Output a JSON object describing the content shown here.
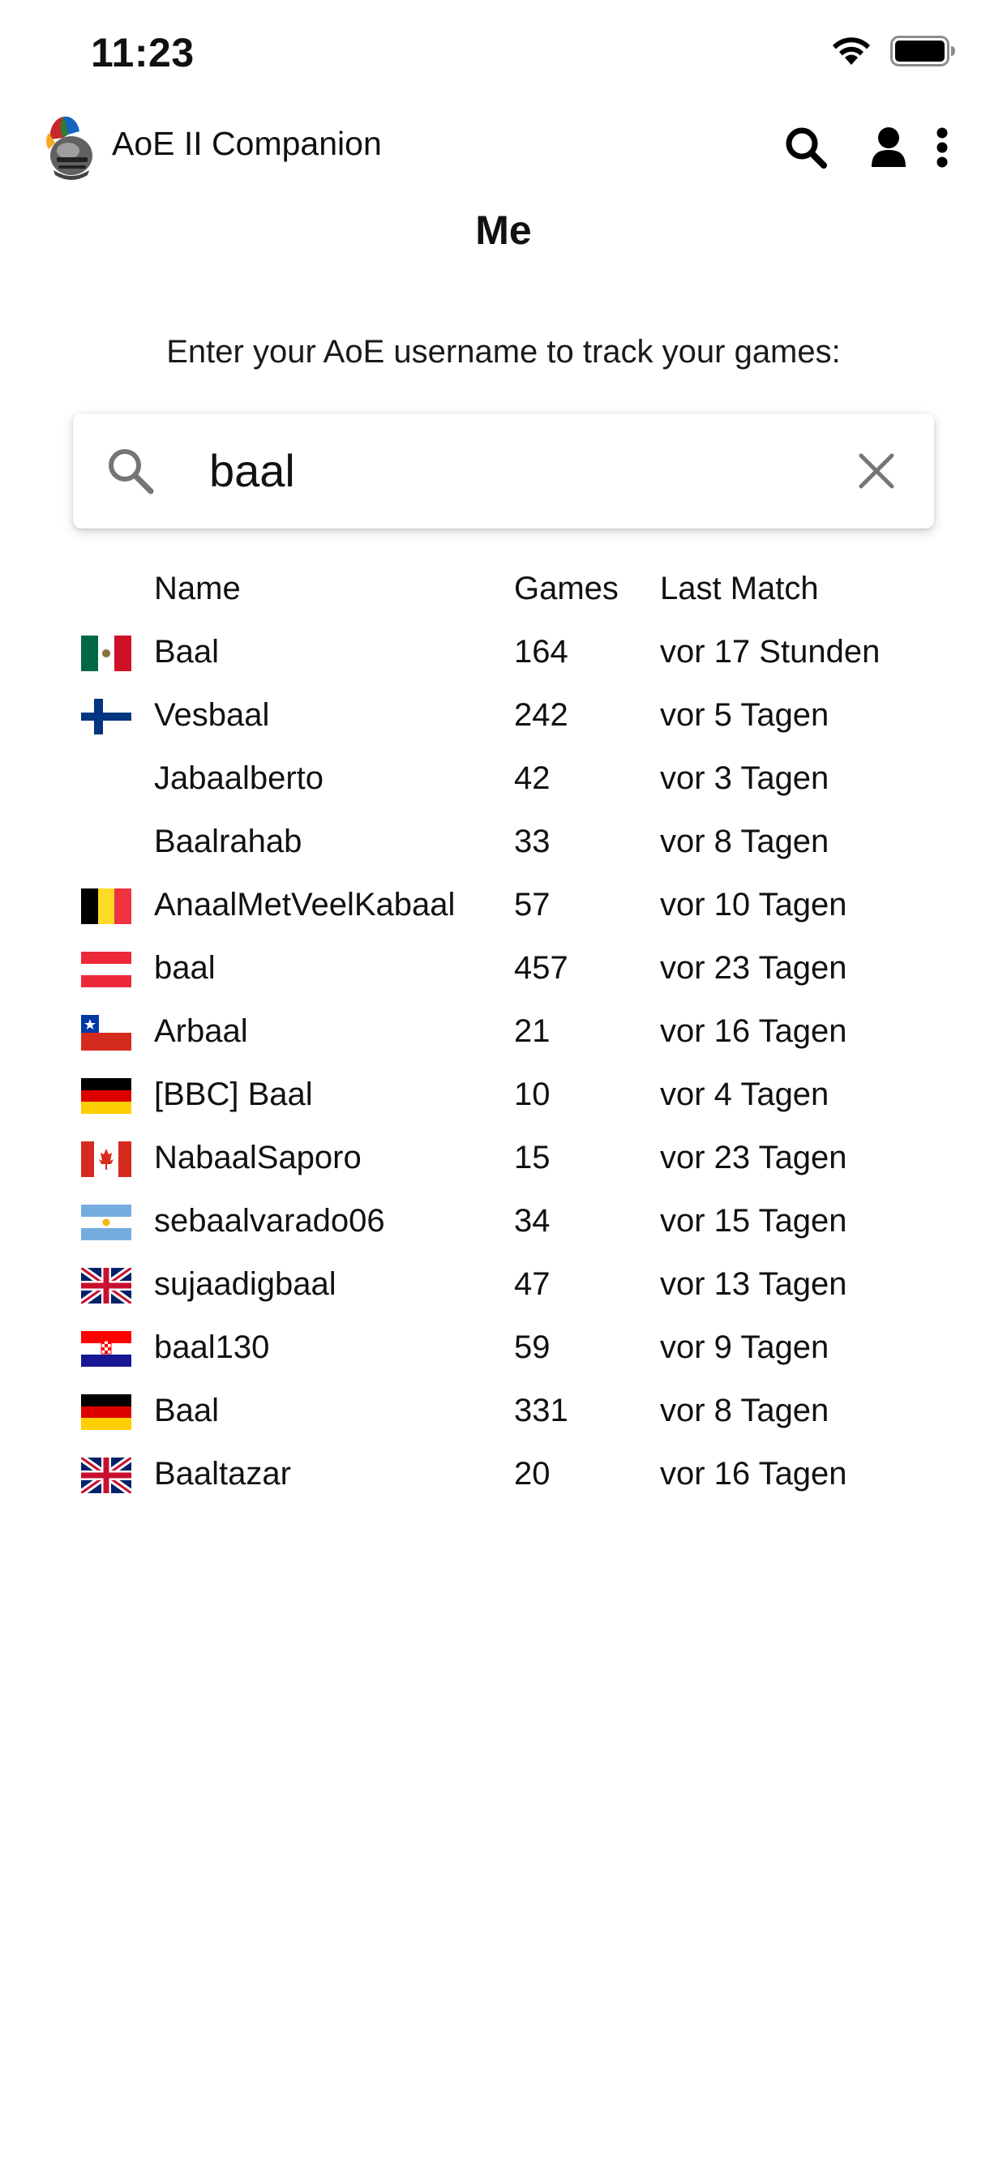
{
  "status_bar": {
    "time": "11:23"
  },
  "app_bar": {
    "title": "AoE II Companion",
    "actions": [
      "search-icon",
      "person-icon",
      "more-vertical-icon"
    ]
  },
  "page": {
    "title": "Me",
    "prompt": "Enter your AoE username to track your games:"
  },
  "search": {
    "value": "baal",
    "placeholder": ""
  },
  "table": {
    "headers": {
      "name": "Name",
      "games": "Games",
      "last_match": "Last Match"
    },
    "rows": [
      {
        "flag": "mx",
        "name": "Baal",
        "games": "164",
        "last_match": "vor 17 Stunden"
      },
      {
        "flag": "fi",
        "name": "Vesbaal",
        "games": "242",
        "last_match": "vor 5 Tagen"
      },
      {
        "flag": "",
        "name": "Jabaalberto",
        "games": "42",
        "last_match": "vor 3 Tagen"
      },
      {
        "flag": "",
        "name": "Baalrahab",
        "games": "33",
        "last_match": "vor 8 Tagen"
      },
      {
        "flag": "be",
        "name": "AnaalMetVeelKabaal",
        "games": "57",
        "last_match": "vor 10 Tagen"
      },
      {
        "flag": "at",
        "name": "baal",
        "games": "457",
        "last_match": "vor 23 Tagen"
      },
      {
        "flag": "cl",
        "name": "Arbaal",
        "games": "21",
        "last_match": "vor 16 Tagen"
      },
      {
        "flag": "de",
        "name": "[BBC] Baal",
        "games": "10",
        "last_match": "vor 4 Tagen"
      },
      {
        "flag": "ca",
        "name": "NabaalSaporo",
        "games": "15",
        "last_match": "vor 23 Tagen"
      },
      {
        "flag": "ar",
        "name": "sebaalvarado06",
        "games": "34",
        "last_match": "vor 15 Tagen"
      },
      {
        "flag": "gb",
        "name": "sujaadigbaal",
        "games": "47",
        "last_match": "vor 13 Tagen"
      },
      {
        "flag": "hr",
        "name": "baal130",
        "games": "59",
        "last_match": "vor 9 Tagen"
      },
      {
        "flag": "de",
        "name": "Baal",
        "games": "331",
        "last_match": "vor 8 Tagen"
      },
      {
        "flag": "gb",
        "name": "Baaltazar",
        "games": "20",
        "last_match": "vor 16 Tagen"
      }
    ]
  }
}
